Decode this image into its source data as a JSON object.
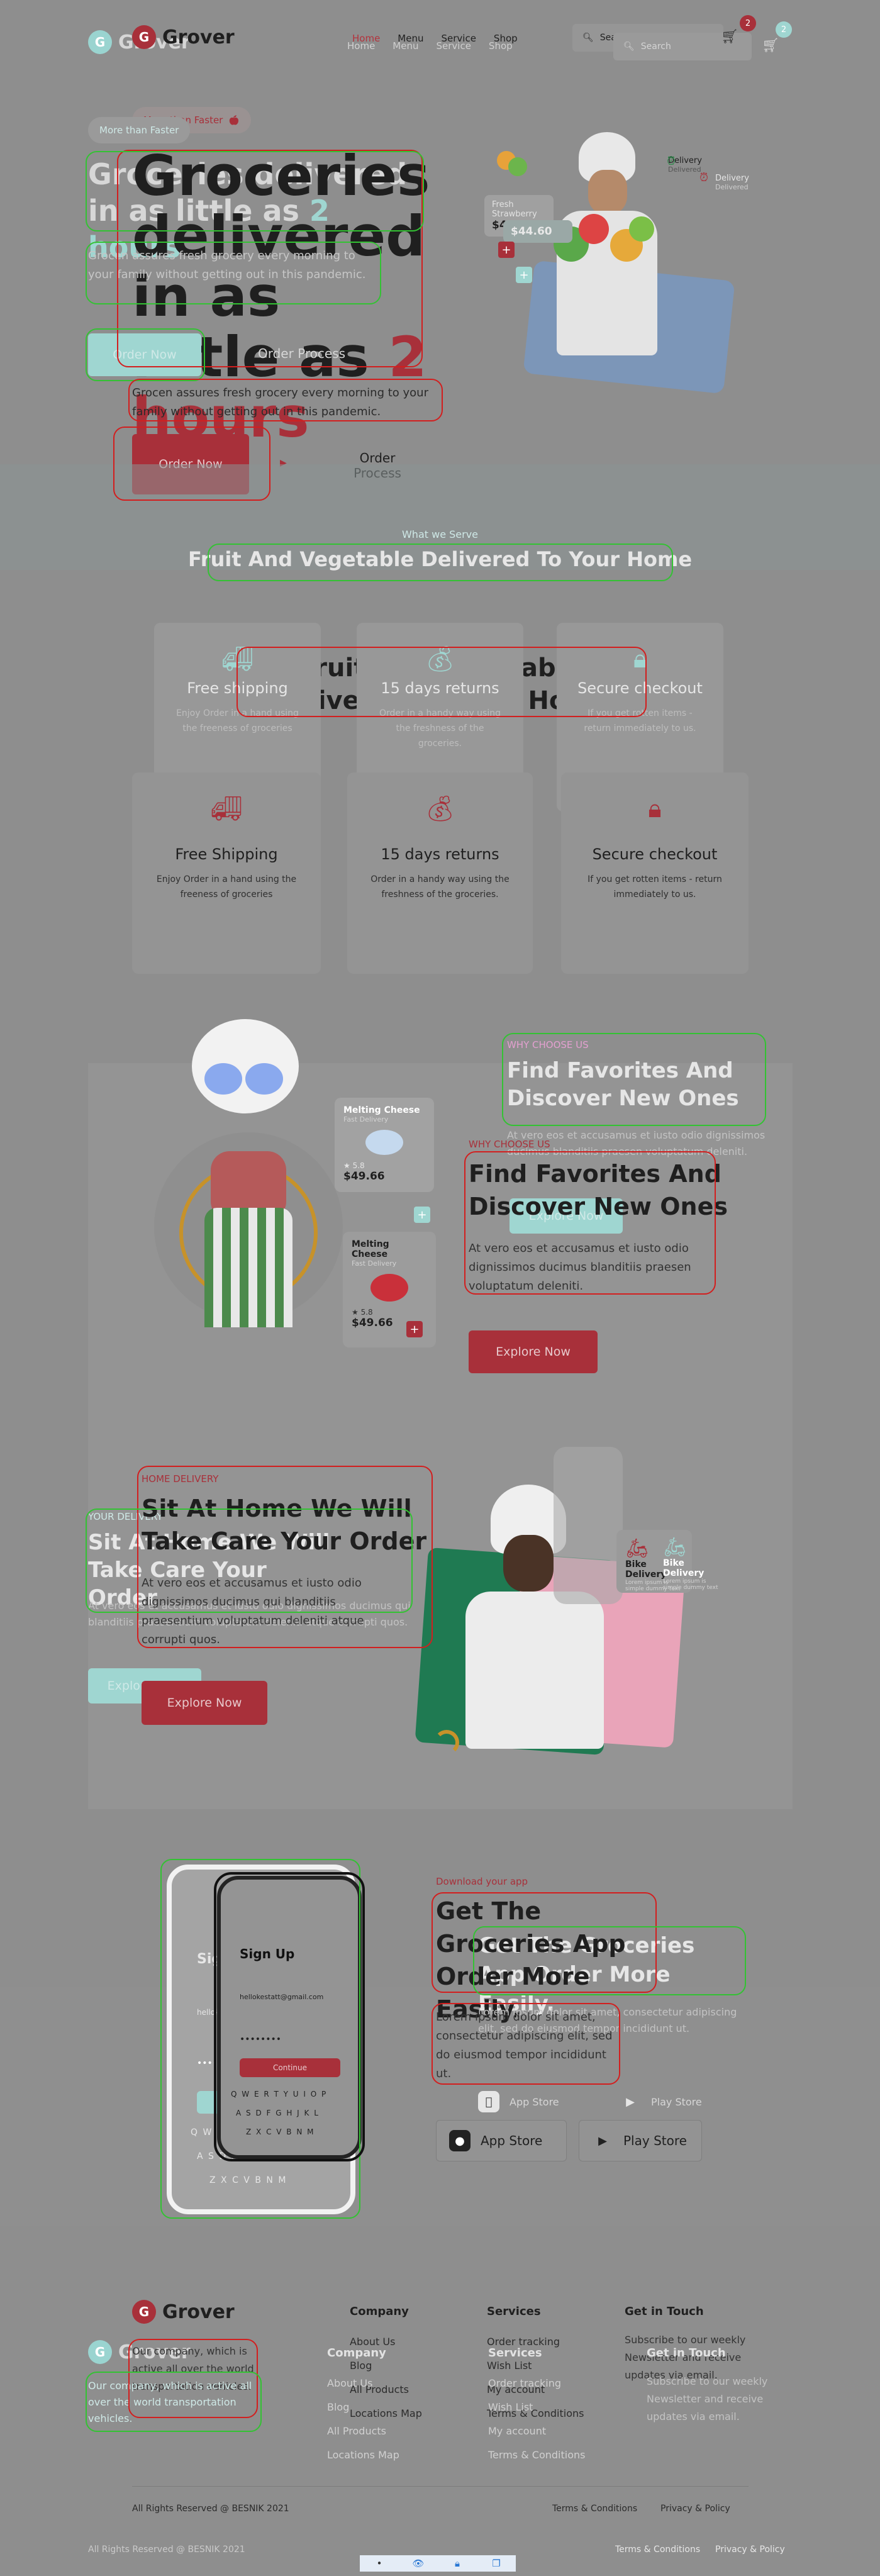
{
  "brand": {
    "name": "Grover",
    "mark": "G",
    "primary_color": "#a8303a",
    "accent_color": "#9fd6d1"
  },
  "nav": {
    "items": [
      "Home",
      "Menu",
      "Service",
      "Shop"
    ]
  },
  "search": {
    "placeholder": "Search"
  },
  "cart": {
    "icon": "cart-icon",
    "count_main": "2",
    "count_ghost": "2"
  },
  "hero": {
    "tagline": "More than Faster",
    "title_lead_main": "Groceries delivered in as little as ",
    "title_highlight_main": "2 hours",
    "title_lead_ghost": "Groceries delivered in as little as ",
    "title_highlight_ghost": "2 hours",
    "description": "Grocen assures fresh grocery every morning to your family without getting out in this pandemic.",
    "order_now": "Order Now",
    "order_process": "Order Process",
    "delivery_label": "Delivery",
    "delivery_sub": "Delivered",
    "product_label": "Fresh Strawberry",
    "product_price": "$44.60"
  },
  "serve": {
    "overline": "What we Serve",
    "title": "Fruit And Vegetable Delivered To Your Home",
    "features_ghost": [
      {
        "icon": "truck-icon",
        "title": "Free shipping",
        "desc": "Enjoy Order in a hand using the freeness of groceries"
      },
      {
        "icon": "money-bag-icon",
        "title": "15 days returns",
        "desc": "Order in a handy way using the freshness of the groceries."
      },
      {
        "icon": "lock-chat-icon",
        "title": "Secure checkout",
        "desc": "If you get rotten items - return immediately to us."
      }
    ],
    "features": [
      {
        "icon": "truck-icon",
        "title": "Free Shipping",
        "desc": "Enjoy Order in a hand using the freeness of groceries"
      },
      {
        "icon": "money-bag-icon",
        "title": "15 days returns",
        "desc": "Order in a handy way using the freshness of the groceries."
      },
      {
        "icon": "lock-chat-icon",
        "title": "Secure checkout",
        "desc": "If you get rotten items - return immediately to us."
      }
    ]
  },
  "why": {
    "overline": "WHY CHOOSE US",
    "title": "Find Favorites And Discover New Ones",
    "desc": "At vero eos et accusamus et iusto odio dignissimos ducimus blanditiis praesen voluptatum deleniti.",
    "cta": "Explore Now",
    "product_1": {
      "name": "Melting Cheese",
      "sub": "Fast Delivery",
      "rating": "★ 5.8",
      "price": "$49.66"
    },
    "product_2": {
      "name": "Melting Cheese",
      "sub": "Fast Delivery",
      "rating": "★ 5.8",
      "price": "$49.66"
    }
  },
  "delivery": {
    "overline": "HOME DELIVERY",
    "overline_ghost": "YOUR DELIVERY",
    "title": "Sit At Home We Will Take Care Your Order",
    "desc": "At vero eos et accusamus et iusto odio dignissimos ducimus qui blanditiis praesentium voluptatum deleniti atque corrupti quos.",
    "cta": "Explore Now",
    "bike_label": "Bike Delivery",
    "bike_sub": "Lorem ipsum is simple dummy text"
  },
  "app": {
    "overline": "Download your app",
    "title": "Get The Groceries App Order More Easily.",
    "desc": "Lorem ipsum dolor sit amet, consectetur adipiscing elit, sed do eiusmod tempor incididunt ut.",
    "app_store": "App Store",
    "play_store": "Play Store",
    "phone": {
      "header": "Sign Up",
      "email": "hellokestatt@gmail.com",
      "password": "••••••••",
      "button": "Continue",
      "keys_row1": "Q W E R T Y U I O P",
      "keys_row2": "A S D F G H J K L",
      "keys_row3": "Z X C V B N M"
    }
  },
  "footer": {
    "about": "Our company, which is active all over the world transportation vehicles.",
    "columns": [
      {
        "title": "Company",
        "links": [
          "About Us",
          "Blog",
          "All Products",
          "Locations Map"
        ]
      },
      {
        "title": "Services",
        "links": [
          "Order tracking",
          "Wish List",
          "My account",
          "Terms & Conditions"
        ]
      },
      {
        "title": "Get in Touch",
        "links": []
      }
    ],
    "newsletter": "Subscribe to our weekly Newsletter and receive updates via email.",
    "copyright": "All Rights Reserved @ BESNIK 2021",
    "terms": "Terms & Conditions",
    "privacy": "Privacy & Policy"
  }
}
